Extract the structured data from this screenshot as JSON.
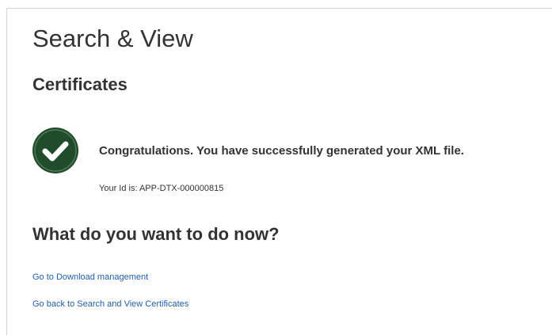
{
  "page": {
    "title": "Search & View",
    "section_title": "Certificates"
  },
  "confirmation": {
    "icon": "check-circle-icon",
    "message": "Congratulations. You have successfully generated your XML file.",
    "reference_id": "Your Id is: APP-DTX-000000815"
  },
  "next_steps": {
    "heading": "What do you want to do now?",
    "links": [
      {
        "label": "Go to Download management"
      },
      {
        "label": "Go back to Search and View Certificates"
      }
    ]
  },
  "colors": {
    "success_green": "#1f4c2a",
    "link_blue": "#1f5fad",
    "text": "#333333",
    "border": "#d4d4d4"
  }
}
